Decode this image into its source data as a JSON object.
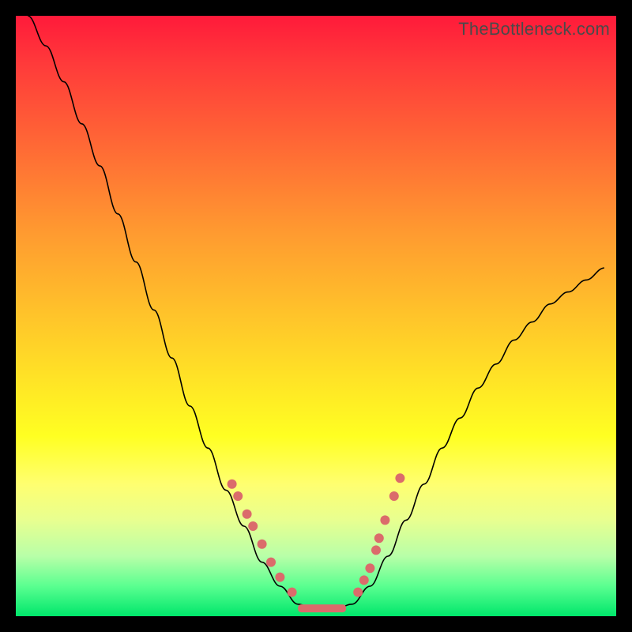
{
  "watermark": "TheBottleneck.com",
  "chart_data": {
    "type": "line",
    "title": "",
    "xlabel": "",
    "ylabel": "",
    "xlim": [
      0,
      100
    ],
    "ylim": [
      0,
      100
    ],
    "series": [
      {
        "name": "bottleneck-curve",
        "x": [
          2,
          5,
          8,
          11,
          14,
          17,
          20,
          23,
          26,
          29,
          32,
          35,
          38,
          41,
          44,
          47,
          50,
          53,
          56,
          59,
          62,
          65,
          68,
          71,
          74,
          77,
          80,
          83,
          86,
          89,
          92,
          95,
          98
        ],
        "values": [
          100,
          95,
          89,
          82,
          75,
          67,
          59,
          51,
          43,
          35,
          28,
          21,
          15,
          9,
          5,
          2,
          1,
          1,
          2,
          5,
          10,
          16,
          22,
          28,
          33,
          38,
          42,
          46,
          49,
          52,
          54,
          56,
          58
        ]
      }
    ],
    "markers_left": [
      {
        "x": 36,
        "y": 22
      },
      {
        "x": 37,
        "y": 20
      },
      {
        "x": 38.5,
        "y": 17
      },
      {
        "x": 39.5,
        "y": 15
      },
      {
        "x": 41,
        "y": 12
      },
      {
        "x": 42.5,
        "y": 9
      },
      {
        "x": 44,
        "y": 6.5
      },
      {
        "x": 46,
        "y": 4
      }
    ],
    "markers_right": [
      {
        "x": 57,
        "y": 4
      },
      {
        "x": 58,
        "y": 6
      },
      {
        "x": 59,
        "y": 8
      },
      {
        "x": 60,
        "y": 11
      },
      {
        "x": 60.5,
        "y": 13
      },
      {
        "x": 61.5,
        "y": 16
      },
      {
        "x": 63,
        "y": 20
      },
      {
        "x": 64,
        "y": 23
      }
    ],
    "flat_segment": {
      "x_start": 47,
      "x_end": 55,
      "y": 1.3
    }
  }
}
